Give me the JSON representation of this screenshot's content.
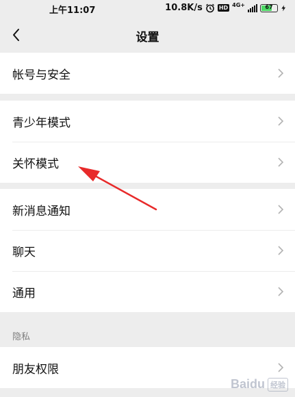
{
  "status_bar": {
    "time": "上午11:07",
    "network_speed": "10.8K/s",
    "network_type": "4G+",
    "hd_badge": "HD",
    "battery_level": "67",
    "battery_fraction": 0.67,
    "icons": [
      "alarm-icon",
      "hd-icon",
      "signal-icon",
      "battery-icon",
      "charging-icon"
    ]
  },
  "header": {
    "title": "设置",
    "back_icon": "chevron-left-icon"
  },
  "groups": [
    {
      "items": [
        {
          "label": "帐号与安全"
        }
      ]
    },
    {
      "items": [
        {
          "label": "青少年模式"
        },
        {
          "label": "关怀模式"
        }
      ]
    },
    {
      "items": [
        {
          "label": "新消息通知"
        },
        {
          "label": "聊天"
        },
        {
          "label": "通用"
        }
      ]
    }
  ],
  "privacy": {
    "section_label": "隐私",
    "items": [
      {
        "label": "朋友权限"
      }
    ]
  },
  "annotation": {
    "arrow_color": "#e82a2a"
  },
  "watermark": {
    "text": "Baidu",
    "sub": "经验"
  }
}
